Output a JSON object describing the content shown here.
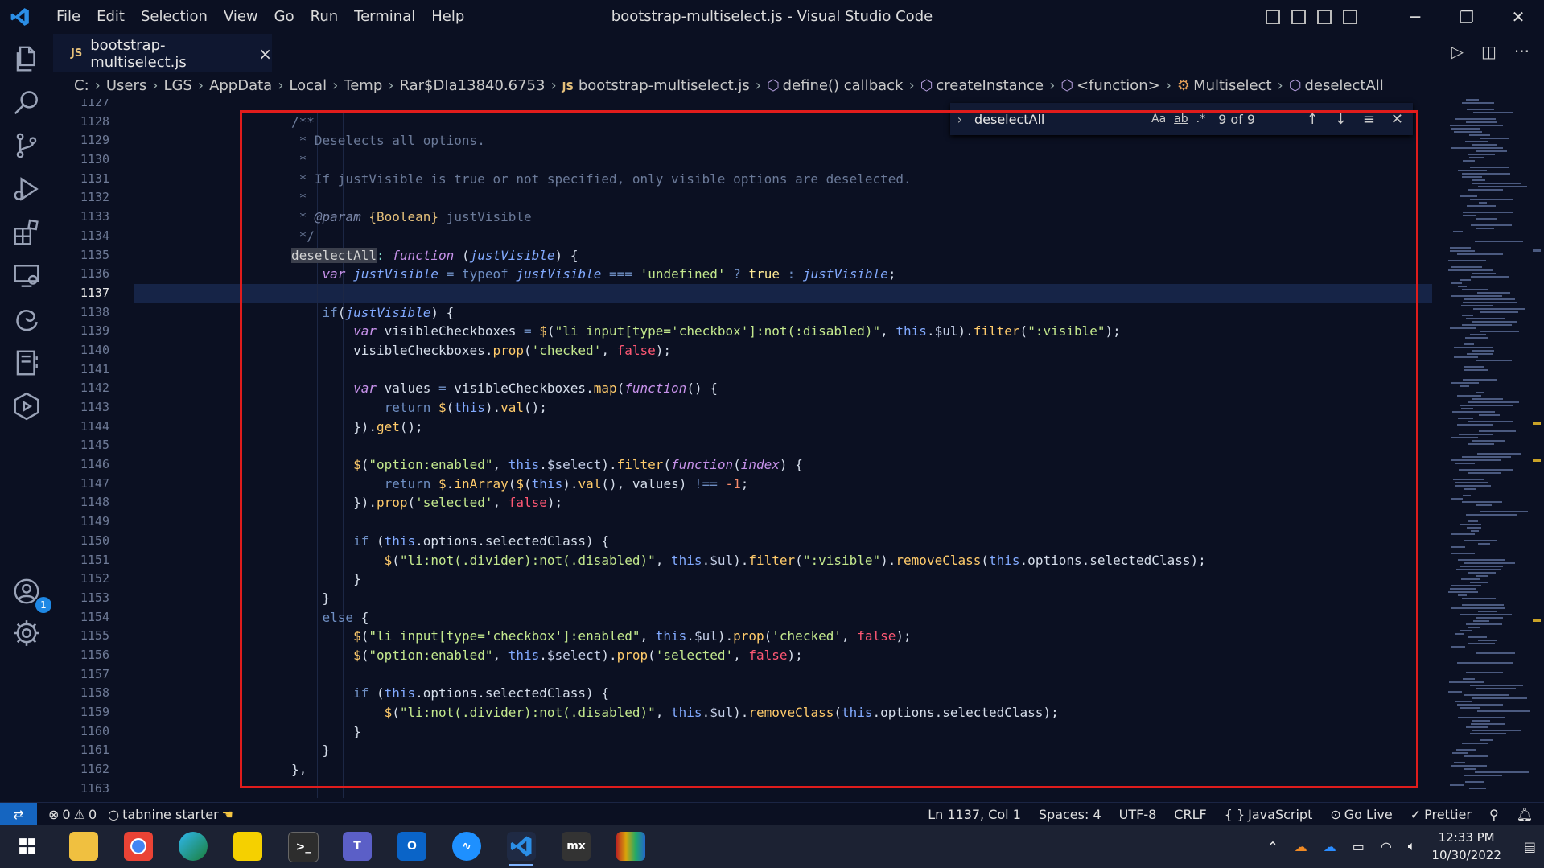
{
  "menu": [
    "File",
    "Edit",
    "Selection",
    "View",
    "Go",
    "Run",
    "Terminal",
    "Help"
  ],
  "window_title": "bootstrap-multiselect.js - Visual Studio Code",
  "tab": {
    "icon_label": "JS",
    "name": "bootstrap-multiselect.js",
    "close": "×"
  },
  "breadcrumb": [
    "C:",
    "Users",
    "LGS",
    "AppData",
    "Local",
    "Temp",
    "Rar$DIa13840.6753",
    "bootstrap-multiselect.js",
    "define() callback",
    "createInstance",
    "<function>",
    "Multiselect",
    "deselectAll"
  ],
  "breadcrumb_js": "JS",
  "find": {
    "value": "deselectAll",
    "match_case": "Aa",
    "whole_word": "ab",
    "regex": ".*",
    "count": "9 of 9"
  },
  "line_numbers": [
    "1127",
    "1128",
    "1129",
    "1130",
    "1131",
    "1132",
    "1133",
    "1134",
    "1135",
    "1136",
    "1137",
    "1138",
    "1139",
    "1140",
    "1141",
    "1142",
    "1143",
    "1144",
    "1145",
    "1146",
    "1147",
    "1148",
    "1149",
    "1150",
    "1151",
    "1152",
    "1153",
    "1154",
    "1155",
    "1156",
    "1157",
    "1158",
    "1159",
    "1160",
    "1161",
    "1162",
    "1163"
  ],
  "current_line": "1137",
  "code": [
    [
      [
        "c-com",
        "/**"
      ]
    ],
    [
      [
        "c-com",
        " * Deselects all options."
      ]
    ],
    [
      [
        "c-com",
        " *"
      ]
    ],
    [
      [
        "c-com",
        " * If justVisible is true or not specified, only visible options are deselected."
      ]
    ],
    [
      [
        "c-com",
        " *"
      ]
    ],
    [
      [
        "c-com",
        " * "
      ],
      [
        "c-doc",
        "@param"
      ],
      [
        "c-com",
        " "
      ],
      [
        "c-type",
        "{Boolean}"
      ],
      [
        "c-com",
        " justVisible"
      ]
    ],
    [
      [
        "c-com",
        " */"
      ]
    ],
    [
      [
        "hl",
        "deselectAll"
      ],
      [
        "c-op",
        ":"
      ],
      [
        "c-plain",
        " "
      ],
      [
        "c-kw",
        "function"
      ],
      [
        "c-plain",
        " ("
      ],
      [
        "c-var c-kw",
        "justVisible"
      ],
      [
        "c-plain",
        ") {"
      ]
    ],
    [
      [
        "c-plain",
        "    "
      ],
      [
        "c-kw",
        "var"
      ],
      [
        "c-plain",
        " "
      ],
      [
        "c-kw c-var",
        "justVisible"
      ],
      [
        "c-plain",
        " "
      ],
      [
        "c-kw2",
        "="
      ],
      [
        "c-plain",
        " "
      ],
      [
        "c-kw2",
        "typeof"
      ],
      [
        "c-plain",
        " "
      ],
      [
        "c-kw c-var",
        "justVisible"
      ],
      [
        "c-plain",
        " "
      ],
      [
        "c-kw2",
        "==="
      ],
      [
        "c-plain",
        " "
      ],
      [
        "c-str",
        "'undefined'"
      ],
      [
        "c-plain",
        " "
      ],
      [
        "c-kw2",
        "?"
      ],
      [
        "c-plain",
        " "
      ],
      [
        "c-true",
        "true"
      ],
      [
        "c-plain",
        " "
      ],
      [
        "c-kw2",
        ":"
      ],
      [
        "c-plain",
        " "
      ],
      [
        "c-kw c-var",
        "justVisible"
      ],
      [
        "c-plain",
        ";"
      ]
    ],
    [
      [
        "c-plain",
        ""
      ]
    ],
    [
      [
        "c-plain",
        "    "
      ],
      [
        "c-kw2",
        "if"
      ],
      [
        "c-plain",
        "("
      ],
      [
        "c-kw c-var",
        "justVisible"
      ],
      [
        "c-plain",
        ") {"
      ]
    ],
    [
      [
        "c-plain",
        "        "
      ],
      [
        "c-kw",
        "var"
      ],
      [
        "c-plain",
        " visibleCheckboxes "
      ],
      [
        "c-kw2",
        "="
      ],
      [
        "c-plain",
        " "
      ],
      [
        "c-fn",
        "$"
      ],
      [
        "c-plain",
        "("
      ],
      [
        "c-str",
        "\"li input[type='checkbox']:not(:disabled)\""
      ],
      [
        "c-plain",
        ", "
      ],
      [
        "c-var",
        "this"
      ],
      [
        "c-plain",
        "."
      ],
      [
        "c-prop",
        "$ul"
      ],
      [
        "c-plain",
        ")."
      ],
      [
        "c-fn",
        "filter"
      ],
      [
        "c-plain",
        "("
      ],
      [
        "c-str",
        "\":visible\""
      ],
      [
        "c-plain",
        ");"
      ]
    ],
    [
      [
        "c-plain",
        "        visibleCheckboxes."
      ],
      [
        "c-fn",
        "prop"
      ],
      [
        "c-plain",
        "("
      ],
      [
        "c-str",
        "'checked'"
      ],
      [
        "c-plain",
        ", "
      ],
      [
        "c-bool",
        "false"
      ],
      [
        "c-plain",
        ");"
      ]
    ],
    [
      [
        "c-plain",
        ""
      ]
    ],
    [
      [
        "c-plain",
        "        "
      ],
      [
        "c-kw",
        "var"
      ],
      [
        "c-plain",
        " values "
      ],
      [
        "c-kw2",
        "="
      ],
      [
        "c-plain",
        " visibleCheckboxes."
      ],
      [
        "c-fn",
        "map"
      ],
      [
        "c-plain",
        "("
      ],
      [
        "c-kw",
        "function"
      ],
      [
        "c-plain",
        "() {"
      ]
    ],
    [
      [
        "c-plain",
        "            "
      ],
      [
        "c-kw2",
        "return"
      ],
      [
        "c-plain",
        " "
      ],
      [
        "c-fn",
        "$"
      ],
      [
        "c-plain",
        "("
      ],
      [
        "c-var",
        "this"
      ],
      [
        "c-plain",
        ")."
      ],
      [
        "c-fn",
        "val"
      ],
      [
        "c-plain",
        "();"
      ]
    ],
    [
      [
        "c-plain",
        "        })."
      ],
      [
        "c-fn",
        "get"
      ],
      [
        "c-plain",
        "();"
      ]
    ],
    [
      [
        "c-plain",
        ""
      ]
    ],
    [
      [
        "c-plain",
        "        "
      ],
      [
        "c-fn",
        "$"
      ],
      [
        "c-plain",
        "("
      ],
      [
        "c-str",
        "\"option:enabled\""
      ],
      [
        "c-plain",
        ", "
      ],
      [
        "c-var",
        "this"
      ],
      [
        "c-plain",
        "."
      ],
      [
        "c-prop",
        "$select"
      ],
      [
        "c-plain",
        ")."
      ],
      [
        "c-fn",
        "filter"
      ],
      [
        "c-plain",
        "("
      ],
      [
        "c-kw",
        "function"
      ],
      [
        "c-plain",
        "("
      ],
      [
        "c-kw c-com",
        "index"
      ],
      [
        "c-plain",
        ") {"
      ]
    ],
    [
      [
        "c-plain",
        "            "
      ],
      [
        "c-kw2",
        "return"
      ],
      [
        "c-plain",
        " "
      ],
      [
        "c-fn",
        "$"
      ],
      [
        "c-plain",
        "."
      ],
      [
        "c-fn",
        "inArray"
      ],
      [
        "c-plain",
        "("
      ],
      [
        "c-fn",
        "$"
      ],
      [
        "c-plain",
        "("
      ],
      [
        "c-var",
        "this"
      ],
      [
        "c-plain",
        ")."
      ],
      [
        "c-fn",
        "val"
      ],
      [
        "c-plain",
        "(), values) "
      ],
      [
        "c-kw2",
        "!=="
      ],
      [
        "c-plain",
        " "
      ],
      [
        "c-num",
        "-1"
      ],
      [
        "c-plain",
        ";"
      ]
    ],
    [
      [
        "c-plain",
        "        })."
      ],
      [
        "c-fn",
        "prop"
      ],
      [
        "c-plain",
        "("
      ],
      [
        "c-str",
        "'selected'"
      ],
      [
        "c-plain",
        ", "
      ],
      [
        "c-bool",
        "false"
      ],
      [
        "c-plain",
        ");"
      ]
    ],
    [
      [
        "c-plain",
        ""
      ]
    ],
    [
      [
        "c-plain",
        "        "
      ],
      [
        "c-kw2",
        "if"
      ],
      [
        "c-plain",
        " ("
      ],
      [
        "c-var",
        "this"
      ],
      [
        "c-plain",
        ".options.selectedClass) {"
      ]
    ],
    [
      [
        "c-plain",
        "            "
      ],
      [
        "c-fn",
        "$"
      ],
      [
        "c-plain",
        "("
      ],
      [
        "c-str",
        "\"li:not(.divider):not(.disabled)\""
      ],
      [
        "c-plain",
        ", "
      ],
      [
        "c-var",
        "this"
      ],
      [
        "c-plain",
        "."
      ],
      [
        "c-prop",
        "$ul"
      ],
      [
        "c-plain",
        ")."
      ],
      [
        "c-fn",
        "filter"
      ],
      [
        "c-plain",
        "("
      ],
      [
        "c-str",
        "\":visible\""
      ],
      [
        "c-plain",
        ")."
      ],
      [
        "c-fn",
        "removeClass"
      ],
      [
        "c-plain",
        "("
      ],
      [
        "c-var",
        "this"
      ],
      [
        "c-plain",
        ".options.selectedClass);"
      ]
    ],
    [
      [
        "c-plain",
        "        }"
      ]
    ],
    [
      [
        "c-plain",
        "    }"
      ]
    ],
    [
      [
        "c-plain",
        "    "
      ],
      [
        "c-kw2",
        "else"
      ],
      [
        "c-plain",
        " {"
      ]
    ],
    [
      [
        "c-plain",
        "        "
      ],
      [
        "c-fn",
        "$"
      ],
      [
        "c-plain",
        "("
      ],
      [
        "c-str",
        "\"li input[type='checkbox']:enabled\""
      ],
      [
        "c-plain",
        ", "
      ],
      [
        "c-var",
        "this"
      ],
      [
        "c-plain",
        "."
      ],
      [
        "c-prop",
        "$ul"
      ],
      [
        "c-plain",
        ")."
      ],
      [
        "c-fn",
        "prop"
      ],
      [
        "c-plain",
        "("
      ],
      [
        "c-str",
        "'checked'"
      ],
      [
        "c-plain",
        ", "
      ],
      [
        "c-bool",
        "false"
      ],
      [
        "c-plain",
        ");"
      ]
    ],
    [
      [
        "c-plain",
        "        "
      ],
      [
        "c-fn",
        "$"
      ],
      [
        "c-plain",
        "("
      ],
      [
        "c-str",
        "\"option:enabled\""
      ],
      [
        "c-plain",
        ", "
      ],
      [
        "c-var",
        "this"
      ],
      [
        "c-plain",
        "."
      ],
      [
        "c-prop",
        "$select"
      ],
      [
        "c-plain",
        ")."
      ],
      [
        "c-fn",
        "prop"
      ],
      [
        "c-plain",
        "("
      ],
      [
        "c-str",
        "'selected'"
      ],
      [
        "c-plain",
        ", "
      ],
      [
        "c-bool",
        "false"
      ],
      [
        "c-plain",
        ");"
      ]
    ],
    [
      [
        "c-plain",
        ""
      ]
    ],
    [
      [
        "c-plain",
        "        "
      ],
      [
        "c-kw2",
        "if"
      ],
      [
        "c-plain",
        " ("
      ],
      [
        "c-var",
        "this"
      ],
      [
        "c-plain",
        ".options.selectedClass) {"
      ]
    ],
    [
      [
        "c-plain",
        "            "
      ],
      [
        "c-fn",
        "$"
      ],
      [
        "c-plain",
        "("
      ],
      [
        "c-str",
        "\"li:not(.divider):not(.disabled)\""
      ],
      [
        "c-plain",
        ", "
      ],
      [
        "c-var",
        "this"
      ],
      [
        "c-plain",
        "."
      ],
      [
        "c-prop",
        "$ul"
      ],
      [
        "c-plain",
        ")."
      ],
      [
        "c-fn",
        "removeClass"
      ],
      [
        "c-plain",
        "("
      ],
      [
        "c-var",
        "this"
      ],
      [
        "c-plain",
        ".options.selectedClass);"
      ]
    ],
    [
      [
        "c-plain",
        "        }"
      ]
    ],
    [
      [
        "c-plain",
        "    }"
      ]
    ],
    [
      [
        "c-plain",
        "},"
      ]
    ],
    [
      [
        "c-plain",
        ""
      ]
    ]
  ],
  "status": {
    "errors": "0",
    "warnings": "0",
    "tabnine": "tabnine starter",
    "position": "Ln 1137, Col 1",
    "spaces": "Spaces: 4",
    "encoding": "UTF-8",
    "eol": "CRLF",
    "language": "JavaScript",
    "golive": "Go Live",
    "prettier": "Prettier"
  },
  "accounts_badge": "1",
  "taskbar": {
    "time": "12:33 PM",
    "date": "10/30/2022",
    "mx_label": "mx"
  },
  "colors": {
    "accent": "#1565c0",
    "highlight_box": "#e01c1c",
    "background": "#0b1022"
  }
}
